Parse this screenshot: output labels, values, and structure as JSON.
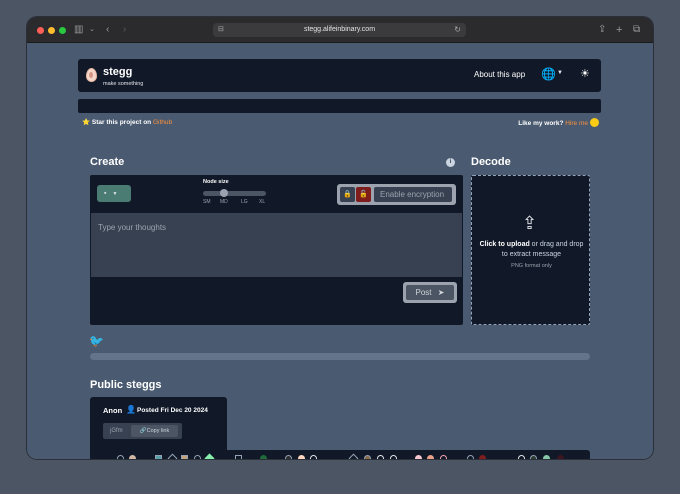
{
  "browser": {
    "url": "stegg.alifeinbinary.com"
  },
  "navbar": {
    "brand_name": "stegg",
    "brand_tagline": "make something",
    "about_label": "About this app",
    "language_icon": "globe-icon",
    "theme_icon": "sun-icon"
  },
  "promo": {
    "star_prefix": "⭐ Star this project on ",
    "star_link": "Github",
    "hire_prefix": "Like my work? ",
    "hire_link": "Hire me"
  },
  "create": {
    "heading": "Create",
    "node_size_label": "Node size",
    "node_size_ticks": [
      "SM",
      "MD",
      "LG",
      "XL"
    ],
    "node_size_selected": "MD",
    "encryption_placeholder": "Enable encryption",
    "thoughts_placeholder": "Type your thoughts",
    "post_label": "Post"
  },
  "decode": {
    "heading": "Decode",
    "upload_bold": "Click to upload",
    "upload_rest": " or drag and drop to extract message",
    "format_note": "PNG format only"
  },
  "public": {
    "heading": "Public steggs",
    "card": {
      "author": "Anon",
      "posted": "Posted Fri Dec 20 2024",
      "id": "jGfm",
      "copy_label": "Copy link"
    }
  },
  "colors": {
    "page_bg": "#4a5a70",
    "panel_bg": "#111827",
    "accent_link": "#fb923c",
    "save_button": "#4a7c73",
    "lock_open": "#7f1d1d"
  }
}
